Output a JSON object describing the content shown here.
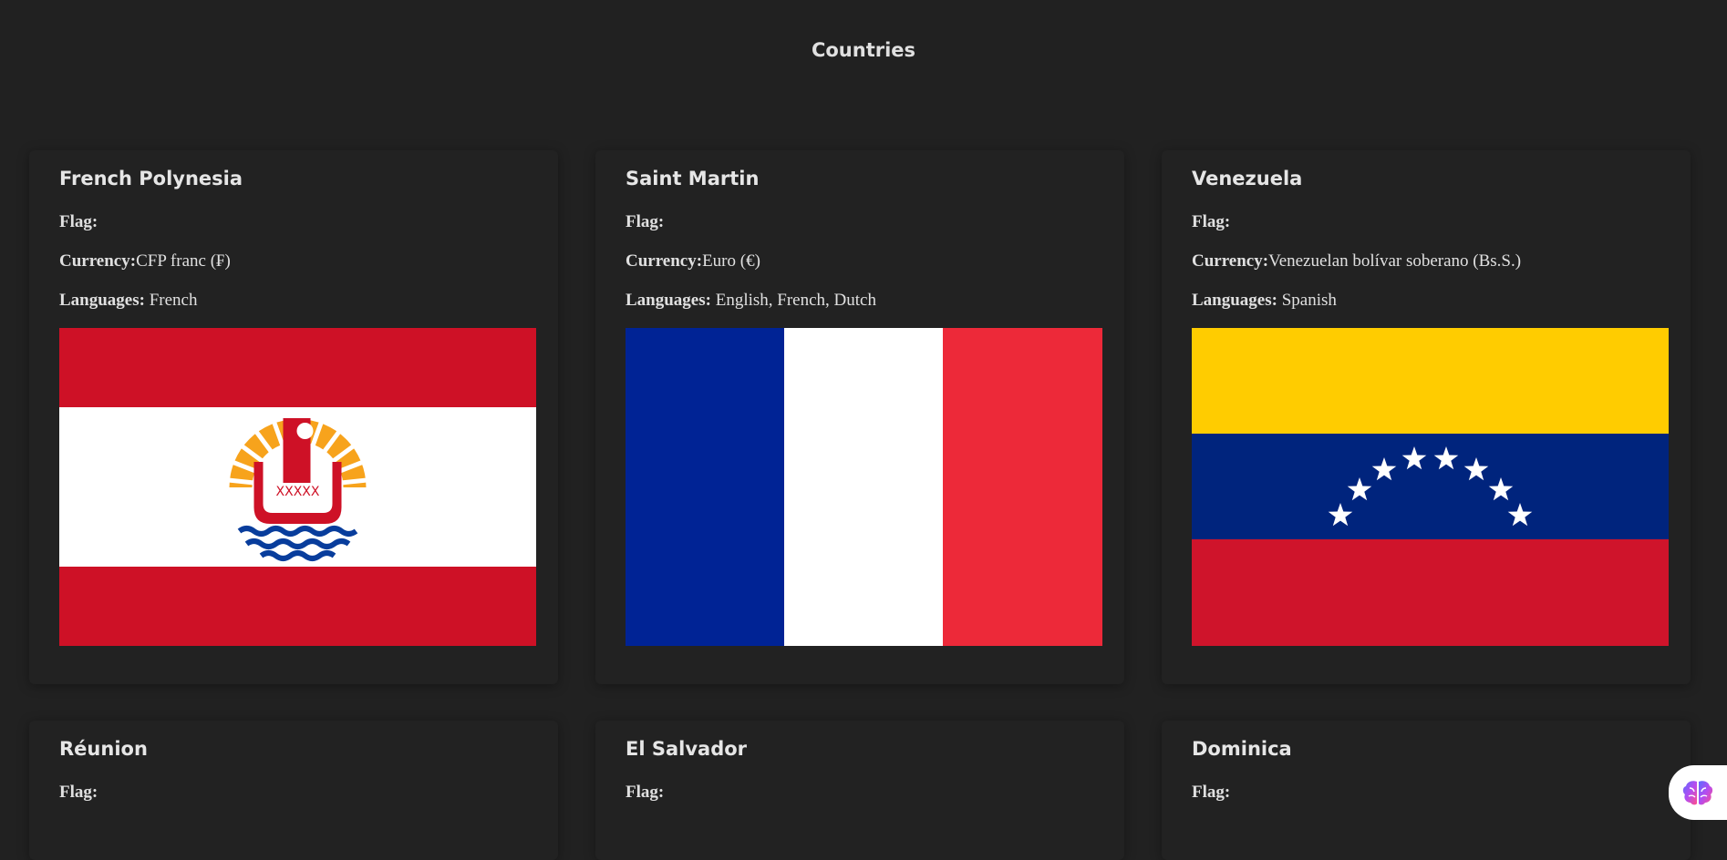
{
  "page": {
    "title": "Countries"
  },
  "labels": {
    "flag": "Flag:",
    "currency": "Currency:",
    "languages": "Languages:"
  },
  "countries": [
    {
      "name": "French Polynesia",
      "currency": "CFP franc (₣)",
      "languages": "French",
      "flag_icon": "french-polynesia-flag"
    },
    {
      "name": "Saint Martin",
      "currency": "Euro (€)",
      "languages": "English, French, Dutch",
      "flag_icon": "france-tricolor-flag"
    },
    {
      "name": "Venezuela",
      "currency": "Venezuelan bolívar soberano (Bs.S.)",
      "languages": "Spanish",
      "flag_icon": "venezuela-flag"
    },
    {
      "name": "Réunion"
    },
    {
      "name": "El Salvador"
    },
    {
      "name": "Dominica"
    }
  ],
  "colors": {
    "background": "#212121",
    "text": "#e0e0e0",
    "fp_red": "#CE1126",
    "fr_blue": "#002395",
    "fr_red": "#ED2939",
    "ve_yellow": "#FFCC00",
    "ve_blue": "#00247D",
    "ve_red": "#CF142B"
  },
  "assistant": {
    "icon": "brain-icon"
  }
}
